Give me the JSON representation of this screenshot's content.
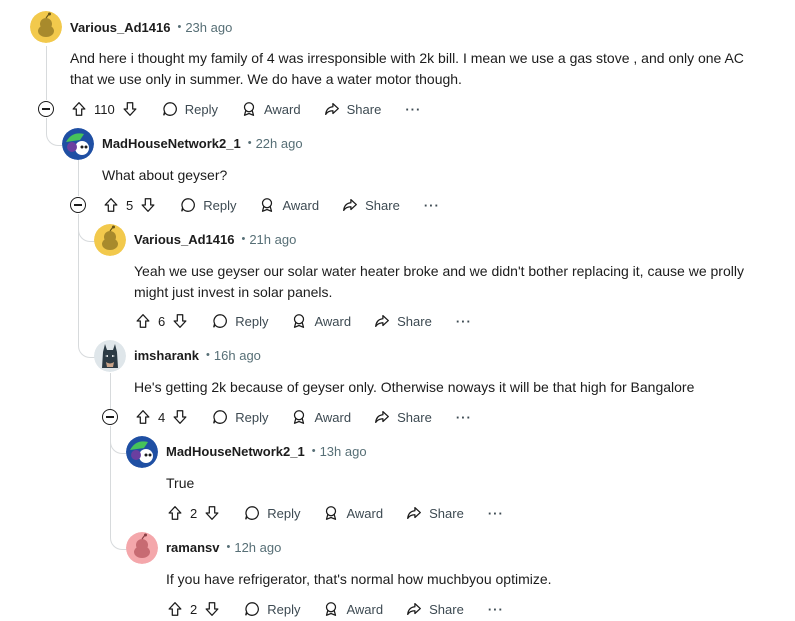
{
  "colors": {
    "snoo_yellow": "#f2c94c",
    "snoo_pink": "#f4a7ab",
    "mhn_blue": "#1f4fa3",
    "mhn_green": "#46c35a",
    "text_muted": "#576f76"
  },
  "comments": [
    {
      "username": "Various_Ad1416",
      "time": "23h ago",
      "body": "And here i thought my family of 4 was irresponsible with 2k bill. I mean we use a gas stove , and only one AC that we use only in summer. We do have a water motor though.",
      "score": "110",
      "reply": "Reply",
      "award": "Award",
      "share": "Share",
      "more": "···",
      "avatar": "snoo-yellow-avatar"
    },
    {
      "username": "MadHouseNetwork2_1",
      "time": "22h ago",
      "body": "What about geyser?",
      "score": "5",
      "reply": "Reply",
      "award": "Award",
      "share": "Share",
      "more": "···",
      "avatar": "madhouse-avatar"
    },
    {
      "username": "Various_Ad1416",
      "time": "21h ago",
      "body": "Yeah we use geyser our solar water heater broke and we didn't bother replacing it, cause we prolly might just invest in solar panels.",
      "score": "6",
      "reply": "Reply",
      "award": "Award",
      "share": "Share",
      "more": "···",
      "avatar": "snoo-yellow-avatar"
    },
    {
      "username": "imsharank",
      "time": "16h ago",
      "body": "He's getting 2k because of geyser only. Otherwise noways it will be that high for Bangalore",
      "score": "4",
      "reply": "Reply",
      "award": "Award",
      "share": "Share",
      "more": "···",
      "avatar": "batman-avatar"
    },
    {
      "username": "MadHouseNetwork2_1",
      "time": "13h ago",
      "body": "True",
      "score": "2",
      "reply": "Reply",
      "award": "Award",
      "share": "Share",
      "more": "···",
      "avatar": "madhouse-avatar"
    },
    {
      "username": "ramansv",
      "time": "12h ago",
      "body": "If you have refrigerator, that's normal how muchbyou optimize.",
      "score": "2",
      "reply": "Reply",
      "award": "Award",
      "share": "Share",
      "more": "···",
      "avatar": "snoo-pink-avatar"
    }
  ]
}
